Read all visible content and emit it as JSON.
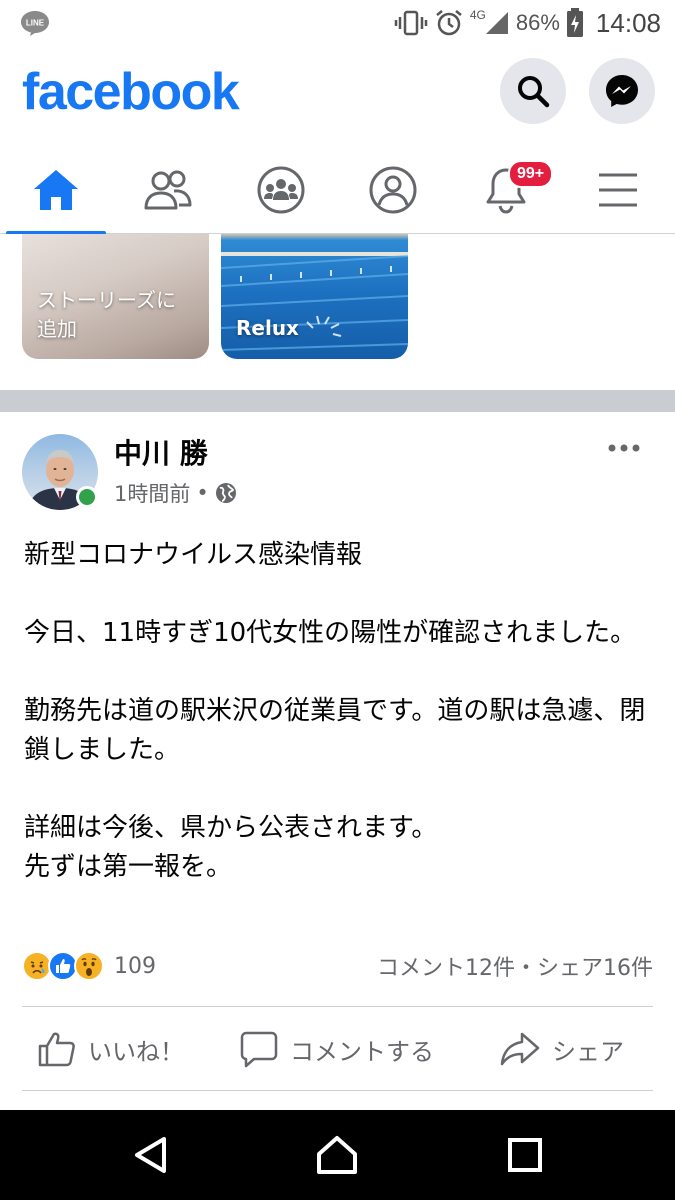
{
  "status_bar": {
    "battery": "86%",
    "time": "14:08",
    "network": "4G",
    "icons": [
      "line-app-icon",
      "vibrate-icon",
      "alarm-icon",
      "signal-icon",
      "battery-icon"
    ]
  },
  "header": {
    "logo": "facebook",
    "brand_color": "#1877f2"
  },
  "tabs": [
    {
      "name": "home",
      "icon": "home-icon",
      "active": true
    },
    {
      "name": "friends",
      "icon": "friends-icon"
    },
    {
      "name": "groups",
      "icon": "groups-icon"
    },
    {
      "name": "profile",
      "icon": "profile-icon"
    },
    {
      "name": "notifications",
      "icon": "bell-icon",
      "badge": "99+"
    },
    {
      "name": "menu",
      "icon": "hamburger-icon"
    }
  ],
  "stories": [
    {
      "label": "ストーリーズに\n追加"
    },
    {
      "label": "Relux"
    }
  ],
  "post": {
    "author": "中川 勝",
    "time": "1時間前",
    "privacy_icon": "globe-icon",
    "paragraphs": [
      "新型コロナウイルス感染情報",
      "今日、11時すぎ10代女性の陽性が確認されました。",
      "勤務先は道の駅米沢の従業員です。道の駅は急遽、閉鎖しました。",
      "詳細は今後、県から公表されます。\n先ずは第一報を。"
    ],
    "reactions": {
      "types": [
        "sad",
        "like",
        "wow"
      ],
      "count": "109"
    },
    "counts_text": "コメント12件・シェア16件",
    "actions": {
      "like": "いいね！",
      "comment": "コメントする",
      "share": "シェア"
    }
  }
}
